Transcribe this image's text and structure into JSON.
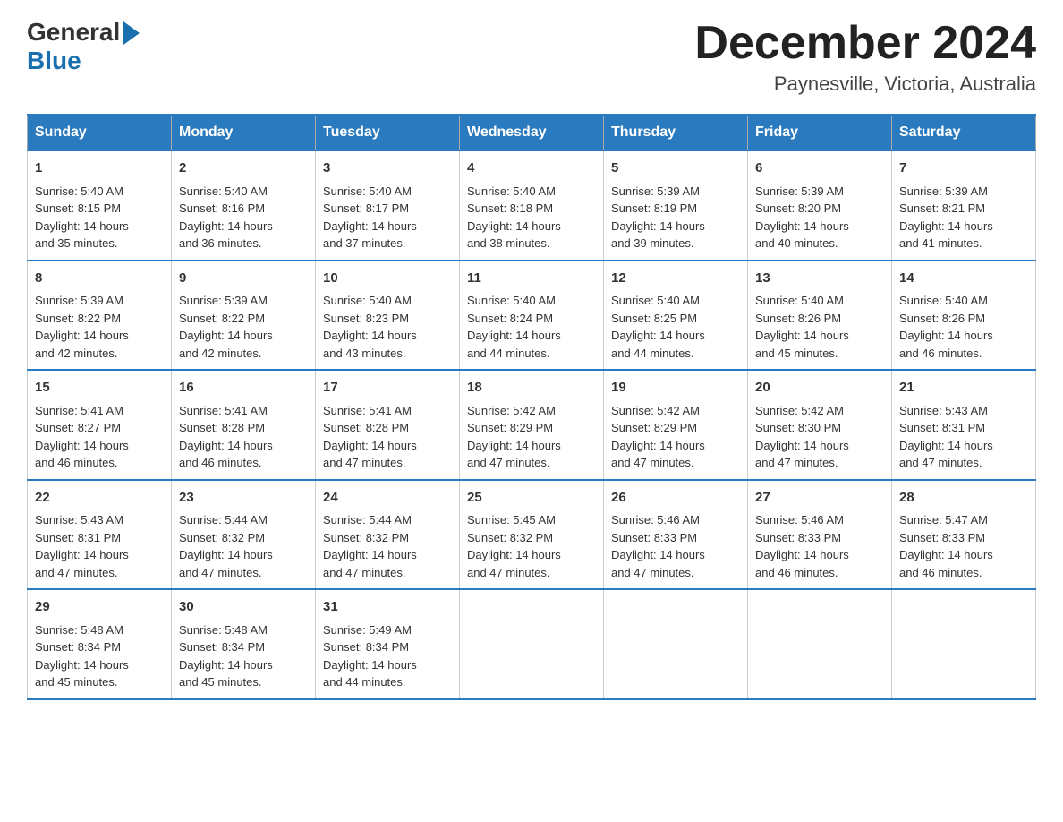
{
  "logo": {
    "general": "General",
    "blue": "Blue"
  },
  "title": "December 2024",
  "location": "Paynesville, Victoria, Australia",
  "days": [
    "Sunday",
    "Monday",
    "Tuesday",
    "Wednesday",
    "Thursday",
    "Friday",
    "Saturday"
  ],
  "weeks": [
    [
      {
        "day": "1",
        "sunrise": "5:40 AM",
        "sunset": "8:15 PM",
        "daylight": "14 hours and 35 minutes."
      },
      {
        "day": "2",
        "sunrise": "5:40 AM",
        "sunset": "8:16 PM",
        "daylight": "14 hours and 36 minutes."
      },
      {
        "day": "3",
        "sunrise": "5:40 AM",
        "sunset": "8:17 PM",
        "daylight": "14 hours and 37 minutes."
      },
      {
        "day": "4",
        "sunrise": "5:40 AM",
        "sunset": "8:18 PM",
        "daylight": "14 hours and 38 minutes."
      },
      {
        "day": "5",
        "sunrise": "5:39 AM",
        "sunset": "8:19 PM",
        "daylight": "14 hours and 39 minutes."
      },
      {
        "day": "6",
        "sunrise": "5:39 AM",
        "sunset": "8:20 PM",
        "daylight": "14 hours and 40 minutes."
      },
      {
        "day": "7",
        "sunrise": "5:39 AM",
        "sunset": "8:21 PM",
        "daylight": "14 hours and 41 minutes."
      }
    ],
    [
      {
        "day": "8",
        "sunrise": "5:39 AM",
        "sunset": "8:22 PM",
        "daylight": "14 hours and 42 minutes."
      },
      {
        "day": "9",
        "sunrise": "5:39 AM",
        "sunset": "8:22 PM",
        "daylight": "14 hours and 42 minutes."
      },
      {
        "day": "10",
        "sunrise": "5:40 AM",
        "sunset": "8:23 PM",
        "daylight": "14 hours and 43 minutes."
      },
      {
        "day": "11",
        "sunrise": "5:40 AM",
        "sunset": "8:24 PM",
        "daylight": "14 hours and 44 minutes."
      },
      {
        "day": "12",
        "sunrise": "5:40 AM",
        "sunset": "8:25 PM",
        "daylight": "14 hours and 44 minutes."
      },
      {
        "day": "13",
        "sunrise": "5:40 AM",
        "sunset": "8:26 PM",
        "daylight": "14 hours and 45 minutes."
      },
      {
        "day": "14",
        "sunrise": "5:40 AM",
        "sunset": "8:26 PM",
        "daylight": "14 hours and 46 minutes."
      }
    ],
    [
      {
        "day": "15",
        "sunrise": "5:41 AM",
        "sunset": "8:27 PM",
        "daylight": "14 hours and 46 minutes."
      },
      {
        "day": "16",
        "sunrise": "5:41 AM",
        "sunset": "8:28 PM",
        "daylight": "14 hours and 46 minutes."
      },
      {
        "day": "17",
        "sunrise": "5:41 AM",
        "sunset": "8:28 PM",
        "daylight": "14 hours and 47 minutes."
      },
      {
        "day": "18",
        "sunrise": "5:42 AM",
        "sunset": "8:29 PM",
        "daylight": "14 hours and 47 minutes."
      },
      {
        "day": "19",
        "sunrise": "5:42 AM",
        "sunset": "8:29 PM",
        "daylight": "14 hours and 47 minutes."
      },
      {
        "day": "20",
        "sunrise": "5:42 AM",
        "sunset": "8:30 PM",
        "daylight": "14 hours and 47 minutes."
      },
      {
        "day": "21",
        "sunrise": "5:43 AM",
        "sunset": "8:31 PM",
        "daylight": "14 hours and 47 minutes."
      }
    ],
    [
      {
        "day": "22",
        "sunrise": "5:43 AM",
        "sunset": "8:31 PM",
        "daylight": "14 hours and 47 minutes."
      },
      {
        "day": "23",
        "sunrise": "5:44 AM",
        "sunset": "8:32 PM",
        "daylight": "14 hours and 47 minutes."
      },
      {
        "day": "24",
        "sunrise": "5:44 AM",
        "sunset": "8:32 PM",
        "daylight": "14 hours and 47 minutes."
      },
      {
        "day": "25",
        "sunrise": "5:45 AM",
        "sunset": "8:32 PM",
        "daylight": "14 hours and 47 minutes."
      },
      {
        "day": "26",
        "sunrise": "5:46 AM",
        "sunset": "8:33 PM",
        "daylight": "14 hours and 47 minutes."
      },
      {
        "day": "27",
        "sunrise": "5:46 AM",
        "sunset": "8:33 PM",
        "daylight": "14 hours and 46 minutes."
      },
      {
        "day": "28",
        "sunrise": "5:47 AM",
        "sunset": "8:33 PM",
        "daylight": "14 hours and 46 minutes."
      }
    ],
    [
      {
        "day": "29",
        "sunrise": "5:48 AM",
        "sunset": "8:34 PM",
        "daylight": "14 hours and 45 minutes."
      },
      {
        "day": "30",
        "sunrise": "5:48 AM",
        "sunset": "8:34 PM",
        "daylight": "14 hours and 45 minutes."
      },
      {
        "day": "31",
        "sunrise": "5:49 AM",
        "sunset": "8:34 PM",
        "daylight": "14 hours and 44 minutes."
      },
      null,
      null,
      null,
      null
    ]
  ],
  "labels": {
    "sunrise": "Sunrise:",
    "sunset": "Sunset:",
    "daylight": "Daylight:"
  }
}
